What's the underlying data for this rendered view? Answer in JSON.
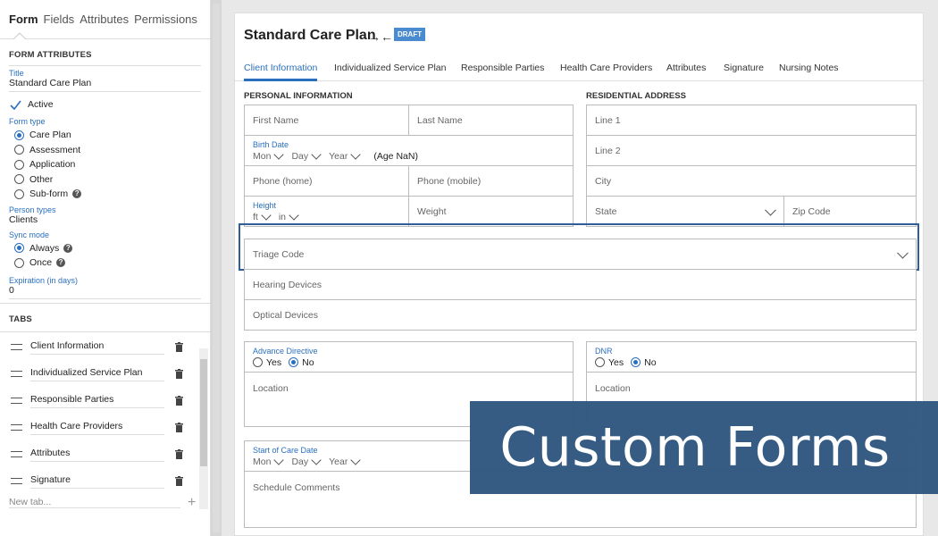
{
  "sidebar": {
    "tabs": [
      "Form",
      "Fields",
      "Attributes",
      "Permissions"
    ],
    "form_attributes_heading": "FORM ATTRIBUTES",
    "title_label": "Title",
    "title_value": "Standard Care Plan",
    "active_label": "Active",
    "form_type_label": "Form type",
    "form_types": [
      "Care Plan",
      "Assessment",
      "Application",
      "Other",
      "Sub-form"
    ],
    "form_type_selected": "Care Plan",
    "person_types_label": "Person types",
    "person_types_value": "Clients",
    "sync_mode_label": "Sync mode",
    "sync_modes": [
      "Always",
      "Once"
    ],
    "sync_mode_selected": "Always",
    "expiration_label": "Expiration (in days)",
    "expiration_value": "0",
    "tabs_heading": "TABS",
    "tab_items": [
      "Client Information",
      "Individualized Service Plan",
      "Responsible Parties",
      "Health Care Providers",
      "Attributes",
      "Signature"
    ],
    "new_tab_placeholder": "New tab...",
    "add_symbol": "+"
  },
  "form": {
    "title": "Standard Care Plan",
    "swap_icon": "swap-arrows-icon",
    "badge": "DRAFT",
    "tabs": [
      "Client Information",
      "Individualized Service Plan",
      "Responsible Parties",
      "Health Care Providers",
      "Attributes",
      "Signature",
      "Nursing Notes"
    ],
    "active_tab": "Client Information",
    "personal_heading": "PERSONAL INFORMATION",
    "address_heading": "RESIDENTIAL ADDRESS",
    "first_name": "First Name",
    "last_name": "Last Name",
    "birth_date_label": "Birth Date",
    "birth_mon": "Mon",
    "birth_day": "Day",
    "birth_year": "Year",
    "age_text": "(Age NaN)",
    "phone_home": "Phone (home)",
    "phone_mobile": "Phone (mobile)",
    "height_label": "Height",
    "height_ft": "ft",
    "height_in": "in",
    "weight": "Weight",
    "line1": "Line 1",
    "line2": "Line 2",
    "city": "City",
    "state": "State",
    "zip": "Zip Code",
    "triage": "Triage Code",
    "hearing": "Hearing Devices",
    "optical": "Optical Devices",
    "advance_label": "Advance Directive",
    "dnr_label": "DNR",
    "yes": "Yes",
    "no": "No",
    "location": "Location",
    "start_care_label": "Start of Care Date",
    "schedule_comments": "Schedule Comments"
  },
  "banner": {
    "text": "Custom Forms",
    "color": "#2f5680"
  },
  "colors": {
    "accent": "#2a6fbf",
    "badge": "#4a8ad0",
    "highlight": "#2f5f99"
  }
}
